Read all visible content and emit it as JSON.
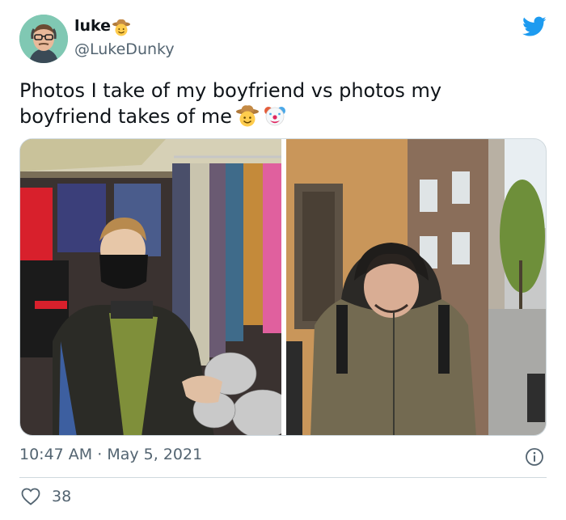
{
  "author": {
    "display_name": "luke",
    "name_emoji": "cowboy-face-emoji",
    "handle": "@LukeDunky"
  },
  "tweet": {
    "text": "Photos I take of my boyfriend vs photos my boyfriend takes of me",
    "emojis": [
      "cowboy-face-emoji",
      "clown-face-emoji"
    ]
  },
  "media": {
    "photos": [
      "left-photo-vintage-shop",
      "right-photo-street"
    ]
  },
  "meta": {
    "time": "10:47 AM",
    "separator": "·",
    "date": "May 5, 2021"
  },
  "engagement": {
    "likes": "38"
  },
  "colors": {
    "twitter_blue": "#1d9bf0",
    "secondary_text": "#536471",
    "divider": "#cfd9de"
  }
}
